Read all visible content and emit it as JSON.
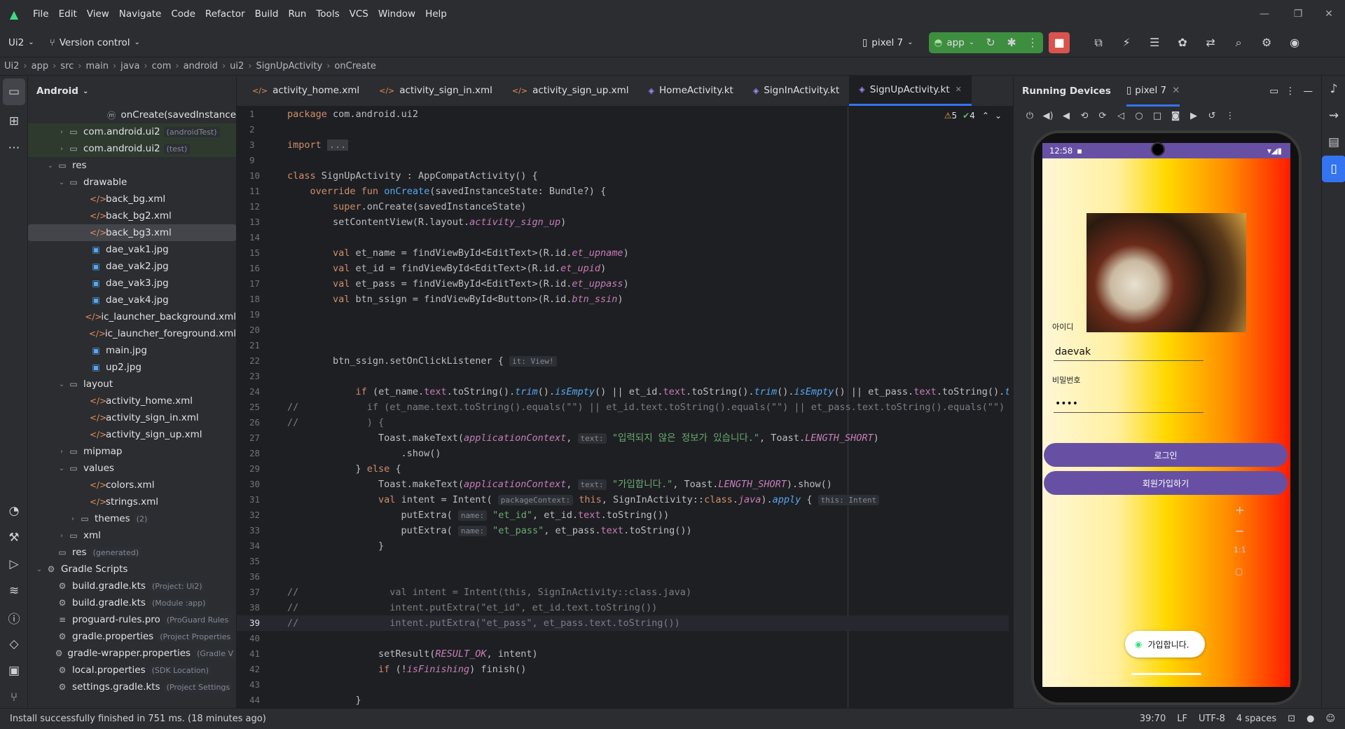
{
  "menu": [
    "File",
    "Edit",
    "View",
    "Navigate",
    "Code",
    "Refactor",
    "Build",
    "Run",
    "Tools",
    "VCS",
    "Window",
    "Help"
  ],
  "toolbar": {
    "project": "Ui2",
    "vcs": "Version control",
    "device": "pixel 7",
    "run_config": "app"
  },
  "breadcrumb": [
    "Ui2",
    "app",
    "src",
    "main",
    "java",
    "com",
    "android",
    "ui2",
    "SignUpActivity",
    "onCreate"
  ],
  "project_panel": {
    "title": "Android",
    "items": [
      {
        "label": "onCreate(savedInstance",
        "hint": "",
        "indent": 96,
        "icon": "ⓜ",
        "mod": false,
        "arrow": ""
      },
      {
        "label": "com.android.ui2",
        "hint": "(androidTest)",
        "indent": 40,
        "icon": "▭",
        "mod": true,
        "arrow": "›"
      },
      {
        "label": "com.android.ui2",
        "hint": "(test)",
        "indent": 40,
        "icon": "▭",
        "mod": true,
        "arrow": "›"
      },
      {
        "label": "res",
        "hint": "",
        "indent": 24,
        "icon": "▭",
        "mod": false,
        "arrow": "⌄"
      },
      {
        "label": "drawable",
        "hint": "",
        "indent": 40,
        "icon": "▭",
        "mod": false,
        "arrow": "⌄"
      },
      {
        "label": "back_bg.xml",
        "hint": "",
        "indent": 72,
        "icon": "</>",
        "mod": false,
        "arrow": ""
      },
      {
        "label": "back_bg2.xml",
        "hint": "",
        "indent": 72,
        "icon": "</>",
        "mod": false,
        "arrow": ""
      },
      {
        "label": "back_bg3.xml",
        "hint": "",
        "indent": 72,
        "icon": "</>",
        "mod": false,
        "arrow": "",
        "sel": true
      },
      {
        "label": "dae_vak1.jpg",
        "hint": "",
        "indent": 72,
        "icon": "▣",
        "mod": false,
        "arrow": ""
      },
      {
        "label": "dae_vak2.jpg",
        "hint": "",
        "indent": 72,
        "icon": "▣",
        "mod": false,
        "arrow": ""
      },
      {
        "label": "dae_vak3.jpg",
        "hint": "",
        "indent": 72,
        "icon": "▣",
        "mod": false,
        "arrow": ""
      },
      {
        "label": "dae_vak4.jpg",
        "hint": "",
        "indent": 72,
        "icon": "▣",
        "mod": false,
        "arrow": ""
      },
      {
        "label": "ic_launcher_background.xml",
        "hint": "",
        "indent": 72,
        "icon": "</>",
        "mod": false,
        "arrow": ""
      },
      {
        "label": "ic_launcher_foreground.xml",
        "hint": "",
        "indent": 72,
        "icon": "</>",
        "mod": false,
        "arrow": ""
      },
      {
        "label": "main.jpg",
        "hint": "",
        "indent": 72,
        "icon": "▣",
        "mod": false,
        "arrow": ""
      },
      {
        "label": "up2.jpg",
        "hint": "",
        "indent": 72,
        "icon": "▣",
        "mod": false,
        "arrow": ""
      },
      {
        "label": "layout",
        "hint": "",
        "indent": 40,
        "icon": "▭",
        "mod": false,
        "arrow": "⌄"
      },
      {
        "label": "activity_home.xml",
        "hint": "",
        "indent": 72,
        "icon": "</>",
        "mod": false,
        "arrow": ""
      },
      {
        "label": "activity_sign_in.xml",
        "hint": "",
        "indent": 72,
        "icon": "</>",
        "mod": false,
        "arrow": ""
      },
      {
        "label": "activity_sign_up.xml",
        "hint": "",
        "indent": 72,
        "icon": "</>",
        "mod": false,
        "arrow": ""
      },
      {
        "label": "mipmap",
        "hint": "",
        "indent": 40,
        "icon": "▭",
        "mod": false,
        "arrow": "›"
      },
      {
        "label": "values",
        "hint": "",
        "indent": 40,
        "icon": "▭",
        "mod": false,
        "arrow": "⌄"
      },
      {
        "label": "colors.xml",
        "hint": "",
        "indent": 72,
        "icon": "</>",
        "mod": false,
        "arrow": ""
      },
      {
        "label": "strings.xml",
        "hint": "",
        "indent": 72,
        "icon": "</>",
        "mod": false,
        "arrow": ""
      },
      {
        "label": "themes",
        "hint": "(2)",
        "indent": 56,
        "icon": "▭",
        "mod": false,
        "arrow": "›"
      },
      {
        "label": "xml",
        "hint": "",
        "indent": 40,
        "icon": "▭",
        "mod": false,
        "arrow": "›"
      },
      {
        "label": "res",
        "hint": "(generated)",
        "indent": 24,
        "icon": "▭",
        "mod": false,
        "arrow": ""
      },
      {
        "label": "Gradle Scripts",
        "hint": "",
        "indent": 8,
        "icon": "⚙",
        "mod": false,
        "arrow": "⌄"
      },
      {
        "label": "build.gradle.kts",
        "hint": "(Project: Ui2)",
        "indent": 24,
        "icon": "⚙",
        "mod": false,
        "arrow": ""
      },
      {
        "label": "build.gradle.kts",
        "hint": "(Module :app)",
        "indent": 24,
        "icon": "⚙",
        "mod": false,
        "arrow": ""
      },
      {
        "label": "proguard-rules.pro",
        "hint": "(ProGuard Rules",
        "indent": 24,
        "icon": "≡",
        "mod": false,
        "arrow": ""
      },
      {
        "label": "gradle.properties",
        "hint": "(Project Properties",
        "indent": 24,
        "icon": "⚙",
        "mod": false,
        "arrow": ""
      },
      {
        "label": "gradle-wrapper.properties",
        "hint": "(Gradle V",
        "indent": 24,
        "icon": "⚙",
        "mod": false,
        "arrow": ""
      },
      {
        "label": "local.properties",
        "hint": "(SDK Location)",
        "indent": 24,
        "icon": "⚙",
        "mod": false,
        "arrow": ""
      },
      {
        "label": "settings.gradle.kts",
        "hint": "(Project Settings",
        "indent": 24,
        "icon": "⚙",
        "mod": false,
        "arrow": ""
      }
    ]
  },
  "tabs": [
    {
      "label": "activity_home.xml",
      "icon": "</>"
    },
    {
      "label": "activity_sign_in.xml",
      "icon": "</>"
    },
    {
      "label": "activity_sign_up.xml",
      "icon": "</>"
    },
    {
      "label": "HomeActivity.kt",
      "icon": "◈"
    },
    {
      "label": "SignInActivity.kt",
      "icon": "◈"
    },
    {
      "label": "SignUpActivity.kt",
      "icon": "◈",
      "active": true
    }
  ],
  "inspections": {
    "warnings": "5",
    "ok": "4"
  },
  "line_numbers": [
    "1",
    "2",
    "3",
    "9",
    "10",
    "11",
    "12",
    "13",
    "14",
    "15",
    "16",
    "17",
    "18",
    "19",
    "20",
    "21",
    "22",
    "23",
    "24",
    "25",
    "26",
    "27",
    "28",
    "29",
    "30",
    "31",
    "32",
    "33",
    "34",
    "35",
    "36",
    "37",
    "38",
    "39",
    "40",
    "41",
    "42",
    "43",
    "44"
  ],
  "current_line_index": 33,
  "devices": {
    "title": "Running Devices",
    "tab": "pixel 7"
  },
  "phone": {
    "time": "12:58",
    "id_label": "아이디",
    "id_value": "daevak",
    "pw_label": "비밀번호",
    "pw_value": "••••",
    "login_button": "로그인",
    "signup_button": "회원가입하기",
    "toast": "가입합니다."
  },
  "status": {
    "message": "Install successfully finished in 751 ms. (18 minutes ago)",
    "position": "39:70",
    "line_sep": "LF",
    "encoding": "UTF-8",
    "indent": "4 spaces"
  }
}
